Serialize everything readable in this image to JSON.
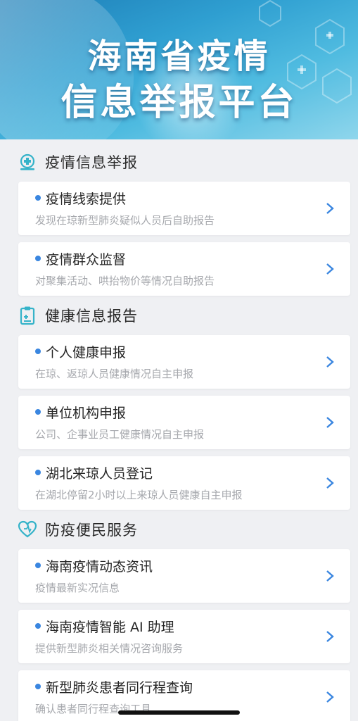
{
  "banner": {
    "title_line1": "海南省疫情",
    "title_line2": "信息举报平台"
  },
  "sections": [
    {
      "title": "疫情信息举报",
      "icon": "medical-cross-icon",
      "items": [
        {
          "title": "疫情线索提供",
          "subtitle": "发现在琼新型肺炎疑似人员后自助报告"
        },
        {
          "title": "疫情群众监督",
          "subtitle": "对聚集活动、哄抬物价等情况自助报告"
        }
      ]
    },
    {
      "title": "健康信息报告",
      "icon": "clipboard-icon",
      "items": [
        {
          "title": "个人健康申报",
          "subtitle": "在琼、返琼人员健康情况自主申报"
        },
        {
          "title": "单位机构申报",
          "subtitle": "公司、企事业员工健康情况自主申报"
        },
        {
          "title": "湖北来琼人员登记",
          "subtitle": "在湖北停留2小时以上来琼人员健康自主申报"
        }
      ]
    },
    {
      "title": "防疫便民服务",
      "icon": "heart-icon",
      "items": [
        {
          "title": "海南疫情动态资讯",
          "subtitle": "疫情最新实况信息"
        },
        {
          "title": "海南疫情智能 AI 助理",
          "subtitle": "提供新型肺炎相关情况咨询服务"
        },
        {
          "title": "新型肺炎患者同行程查询",
          "subtitle": "确认患者同行程查询工具"
        }
      ]
    }
  ],
  "colors": {
    "accent": "#3a86e0",
    "icon": "#35b3c9",
    "background": "#eff0f3"
  }
}
